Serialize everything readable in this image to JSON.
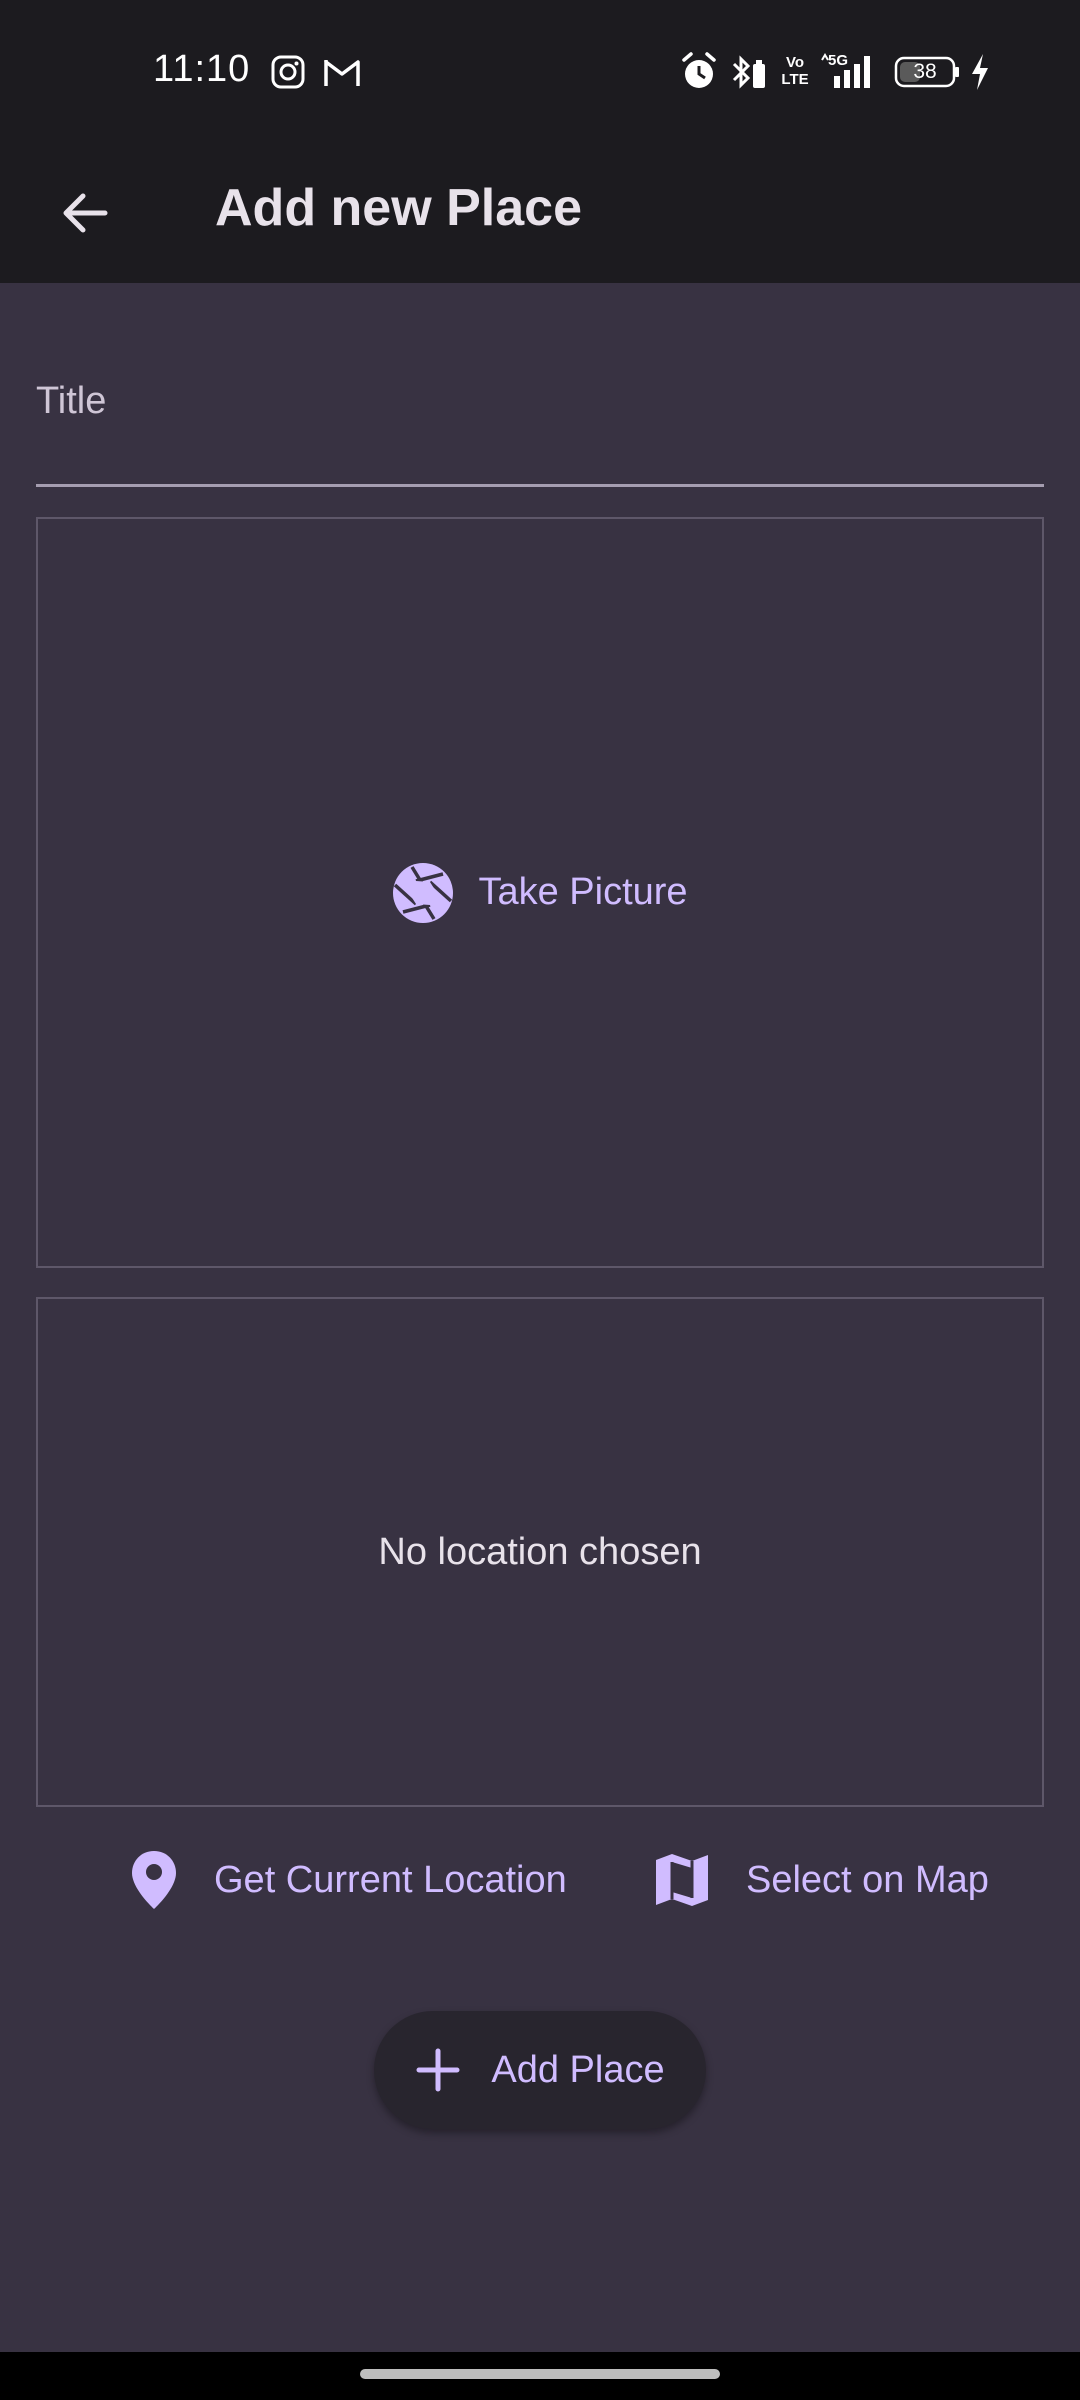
{
  "status_bar": {
    "time": "11:10",
    "left_icons": [
      "instagram-icon",
      "gmail-icon"
    ],
    "right_icons": [
      "alarm-icon",
      "bluetooth-battery-icon",
      "volte-icon",
      "5g-signal-icon",
      "battery-icon",
      "charging-icon"
    ],
    "network": "5G",
    "volte_top": "Vo",
    "volte_bottom": "LTE",
    "battery_level": "38"
  },
  "app_bar": {
    "title": "Add new Place",
    "back_icon": "arrow-back-icon"
  },
  "form": {
    "title_label": "Title",
    "title_value": ""
  },
  "picture": {
    "button_label": "Take Picture",
    "icon": "camera-shutter-icon"
  },
  "location": {
    "preview_text": "No location chosen",
    "current_location_label": "Get Current Location",
    "current_location_icon": "location-pin-icon",
    "select_on_map_label": "Select on Map",
    "select_on_map_icon": "map-icon"
  },
  "actions": {
    "add_place_label": "Add Place",
    "add_place_icon": "plus-icon"
  },
  "colors": {
    "background": "#383242",
    "app_bar": "#1c1b1f",
    "accent": "#d0bcff",
    "text": "#e8e2ea",
    "border": "#5e5769"
  }
}
